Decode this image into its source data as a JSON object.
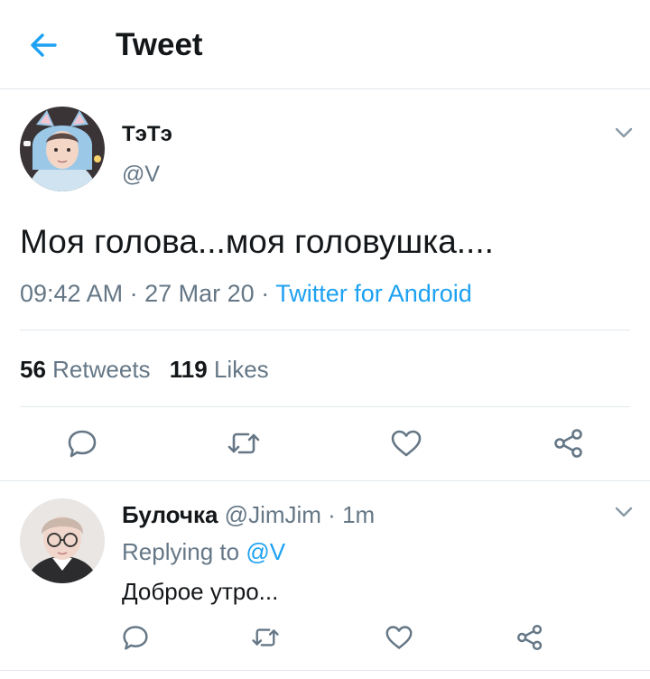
{
  "header": {
    "title": "Tweet",
    "back_icon": "arrow-left-icon"
  },
  "tweet": {
    "display_name": "ТэТэ",
    "handle": "@V",
    "text": "Моя голова...моя головушка....",
    "time": "09:42 AM",
    "sep1": "·",
    "date": "27 Mar 20",
    "sep2": "·",
    "source": "Twitter for Android",
    "retweets_count": "56",
    "retweets_label": "Retweets",
    "likes_count": "119",
    "likes_label": "Likes",
    "actions": [
      "reply-icon",
      "retweet-icon",
      "like-icon",
      "share-icon"
    ]
  },
  "reply": {
    "display_name": "Булочка",
    "handle": "@JimJim",
    "sep": "·",
    "age": "1m",
    "replying_prefix": "Replying to",
    "replying_handle": "@V",
    "text": "Доброе утро...",
    "actions": [
      "reply-icon",
      "retweet-icon",
      "like-icon",
      "share-icon"
    ]
  },
  "colors": {
    "accent": "#1da1f2",
    "secondary_text": "#657786",
    "primary_text": "#14171a",
    "divider": "#e1e8ed"
  }
}
